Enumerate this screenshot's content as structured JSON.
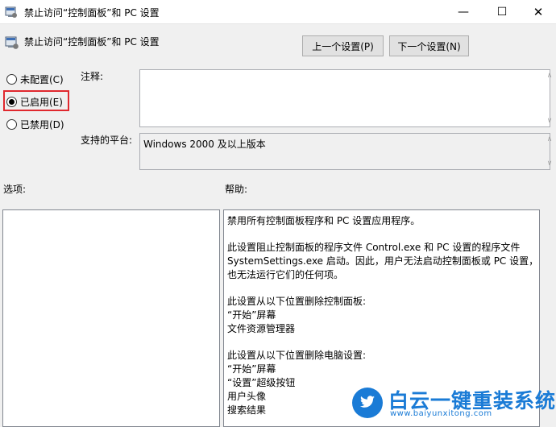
{
  "window": {
    "title": "禁止访问“控制面板”和 PC 设置",
    "minimize_glyph": "—",
    "maximize_glyph": "☐",
    "close_glyph": "✕"
  },
  "header": {
    "title": "禁止访问“控制面板”和 PC 设置",
    "prev_button": "上一个设置(P)",
    "next_button": "下一个设置(N)"
  },
  "state": {
    "options": [
      {
        "label": "未配置(C)",
        "selected": false
      },
      {
        "label": "已启用(E)",
        "selected": true
      },
      {
        "label": "已禁用(D)",
        "selected": false
      }
    ],
    "highlight_color": "#e0282e"
  },
  "comment": {
    "label": "注释:",
    "value": ""
  },
  "platform": {
    "label": "支持的平台:",
    "value": "Windows 2000 及以上版本"
  },
  "options_section": {
    "label": "选项:"
  },
  "help": {
    "label": "帮助:",
    "lines": [
      "禁用所有控制面板程序和 PC 设置应用程序。",
      "",
      "此设置阻止控制面板的程序文件 Control.exe 和 PC 设置的程序文件",
      "SystemSettings.exe 启动。因此，用户无法启动控制面板或 PC 设置，",
      "也无法运行它们的任何项。",
      "",
      "此设置从以下位置删除控制面板:",
      "“开始”屏幕",
      "文件资源管理器",
      "",
      "此设置从以下位置删除电脑设置:",
      "“开始”屏幕",
      "“设置”超级按钮",
      "用户头像",
      "搜索结果"
    ]
  },
  "watermark": {
    "text": "白云一键重装系统",
    "url": "www.baiyunxitong.com",
    "color": "#1a7bd6"
  },
  "icons": {
    "app": "policy-settings-icon",
    "header": "policy-settings-icon"
  }
}
